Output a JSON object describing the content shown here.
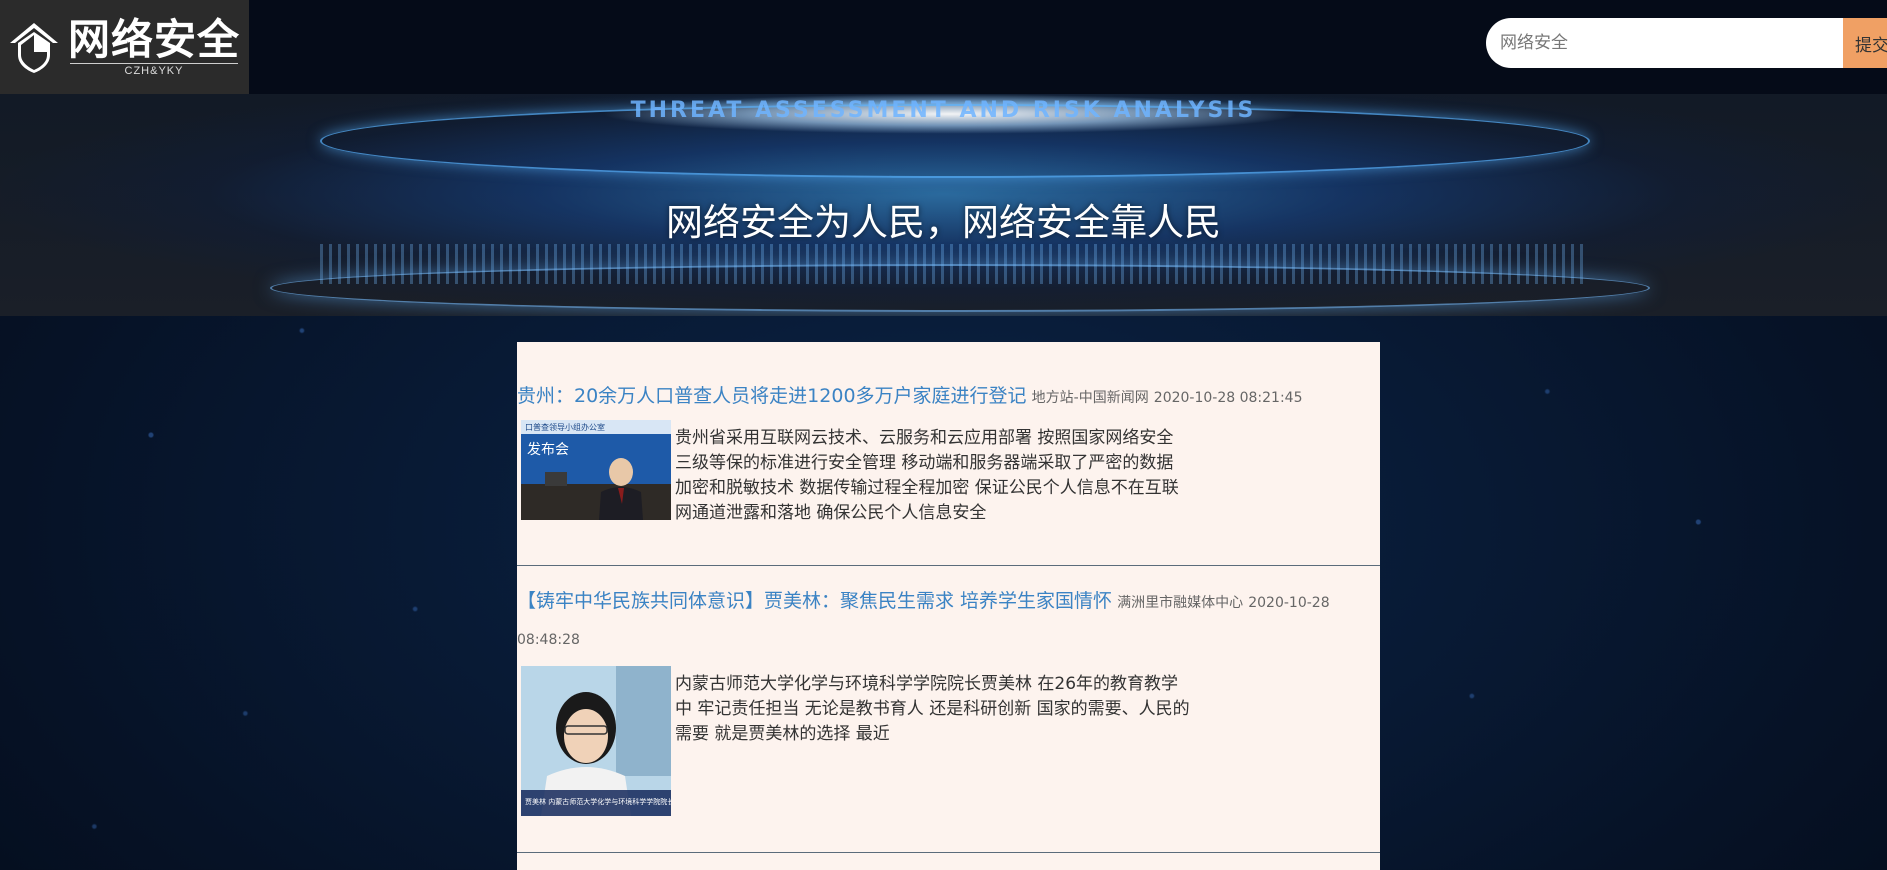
{
  "header": {
    "logo_title": "网络安全",
    "logo_subtitle": "CZH&YKY",
    "search": {
      "placeholder": "网络安全",
      "button_label": "提交"
    }
  },
  "banner": {
    "caption": "THREAT ASSESSMENT AND RISK ANALYSIS",
    "slogan": "网络安全为人民，网络安全靠人民"
  },
  "news": [
    {
      "title": "贵州：20余万人口普查人员将走进1200多万户家庭进行登记",
      "source": "地方站-中国新闻网",
      "time": "2020-10-28 08:21:45",
      "summary": "贵州省采用互联网云技术、云服务和云应用部署 按照国家网络安全三级等保的标准进行安全管理 移动端和服务器端采取了严密的数据加密和脱敏技术 数据传输过程全程加密 保证公民个人信息不在互联网通道泄露和落地 确保公民个人信息安全",
      "thumb_text": [
        "口普查领导小组办公室",
        "发布会"
      ]
    },
    {
      "title": "【铸牢中华民族共同体意识】贾美林：聚焦民生需求 培养学生家国情怀",
      "source": "满洲里市融媒体中心",
      "time": "2020-10-28 08:48:28",
      "summary": "内蒙古师范大学化学与环境科学学院院长贾美林 在26年的教育教学中 牢记责任担当 无论是教书育人 还是科研创新 国家的需要、人民的需要 就是贾美林的选择 最近",
      "thumb_text": [
        "贾美林 内蒙古师范大学化学与环境科学学院院长"
      ]
    }
  ],
  "colors": {
    "title_link": "#3b83c4",
    "panel_bg": "#fdf3ee",
    "search_button": "#f0a064"
  }
}
